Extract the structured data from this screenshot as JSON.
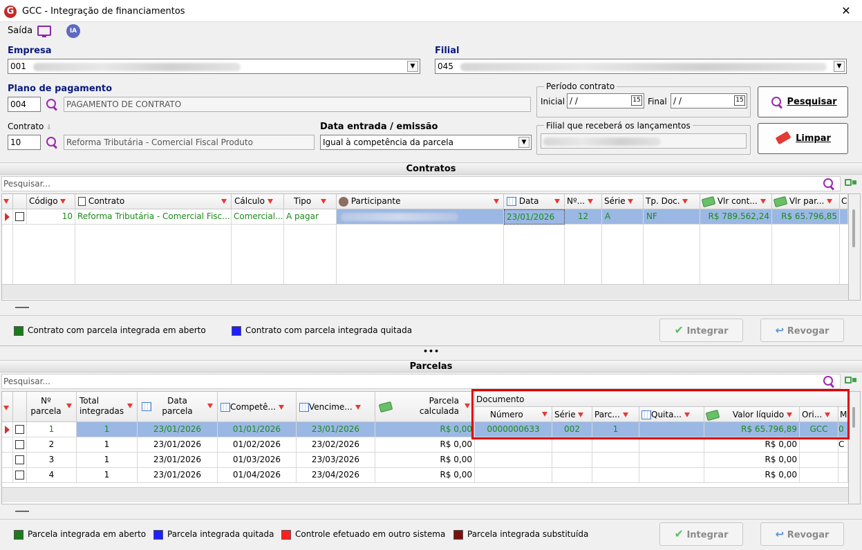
{
  "window": {
    "title": "GCC - Integração de financiamentos",
    "close": "✕",
    "logo": "G"
  },
  "toolbar": {
    "saida": "Saída",
    "ia": "IA"
  },
  "empresa": {
    "label": "Empresa",
    "code": "001"
  },
  "filial": {
    "label": "Filial",
    "code": "045"
  },
  "plano": {
    "label": "Plano de pagamento",
    "code": "004",
    "desc": "PAGAMENTO DE CONTRATO"
  },
  "periodo": {
    "label": "Período contrato",
    "inicial_label": "Inicial",
    "inicial_value": "/ /",
    "final_label": "Final",
    "final_value": "/ /",
    "cal": "15"
  },
  "contrato": {
    "label": "Contrato",
    "code": "10",
    "desc": "Reforma Tributária - Comercial Fiscal Produto"
  },
  "data_entrada": {
    "label": "Data entrada / emissão",
    "value": "Igual à competência da parcela"
  },
  "filial_receb": {
    "label": "Filial que receberá os lançamentos"
  },
  "buttons": {
    "pesquisar": "Pesquisar",
    "limpar": "Limpar",
    "integrar": "Integrar",
    "revogar": "Revogar"
  },
  "contratos": {
    "title": "Contratos",
    "search_placeholder": "Pesquisar...",
    "headers": {
      "codigo": "Código",
      "contrato": "Contrato",
      "calculo": "Cálculo",
      "tipo": "Tipo",
      "participante": "Participante",
      "data": "Data",
      "num": "Nº...",
      "serie": "Série",
      "tpdoc": "Tp. Doc.",
      "vlrcont": "Vlr cont...",
      "vlrpar": "Vlr par...",
      "extra": "C"
    },
    "row": {
      "codigo": "10",
      "contrato": "Reforma Tributária - Comercial Fisc...",
      "calculo": "Comercial...",
      "tipo": "A pagar",
      "data": "23/01/2026",
      "num": "12",
      "serie": "A",
      "tpdoc": "NF",
      "vlrcont": "R$ 789.562,24",
      "vlrpar": "R$ 65.796,85"
    }
  },
  "legend_contratos": {
    "open": "Contrato com parcela integrada em aberto",
    "paid": "Contrato com parcela integrada quitada"
  },
  "divider": "•••",
  "parcelas": {
    "title": "Parcelas",
    "search_placeholder": "Pesquisar...",
    "headers": {
      "nparcela_1": "Nº",
      "nparcela_2": "parcela",
      "total_1": "Total",
      "total_2": "integradas",
      "data_1": "Data",
      "data_2": "parcela",
      "compet": "Competê...",
      "venc": "Vencime...",
      "calc_1": "Parcela",
      "calc_2": "calculada",
      "documento": "Documento",
      "numero": "Número",
      "serie": "Série",
      "parc": "Parc...",
      "quita": "Quita...",
      "valor": "Valor líquido",
      "ori": "Ori...",
      "m": "M"
    },
    "rows": [
      {
        "n": "1",
        "total": "1",
        "data": "23/01/2026",
        "compet": "01/01/2026",
        "venc": "23/01/2026",
        "calc": "R$ 0,00",
        "numero": "0000000633",
        "serie": "002",
        "parc": "1",
        "valor": "R$ 65.796,89",
        "ori": "GCC",
        "m": "0"
      },
      {
        "n": "2",
        "total": "1",
        "data": "23/01/2026",
        "compet": "01/02/2026",
        "venc": "23/02/2026",
        "calc": "R$ 0,00",
        "numero": "",
        "serie": "",
        "parc": "",
        "valor": "R$ 0,00",
        "ori": "",
        "m": "C"
      },
      {
        "n": "3",
        "total": "1",
        "data": "23/01/2026",
        "compet": "01/03/2026",
        "venc": "23/03/2026",
        "calc": "R$ 0,00",
        "numero": "",
        "serie": "",
        "parc": "",
        "valor": "R$ 0,00",
        "ori": "",
        "m": ""
      },
      {
        "n": "4",
        "total": "1",
        "data": "23/01/2026",
        "compet": "01/04/2026",
        "venc": "23/04/2026",
        "calc": "R$ 0,00",
        "numero": "",
        "serie": "",
        "parc": "",
        "valor": "R$ 0,00",
        "ori": "",
        "m": ""
      }
    ]
  },
  "legend_parcelas": {
    "open": "Parcela integrada em aberto",
    "paid": "Parcela integrada quitada",
    "other": "Controle efetuado em outro sistema",
    "subst": "Parcela integrada substituída"
  },
  "colors": {
    "open": "#1b7a1b",
    "paid": "#1f1fff",
    "other": "#ff1f1f",
    "subst": "#7a0f0f",
    "selected": "#9bb8e4",
    "highlight": "#e00000"
  }
}
